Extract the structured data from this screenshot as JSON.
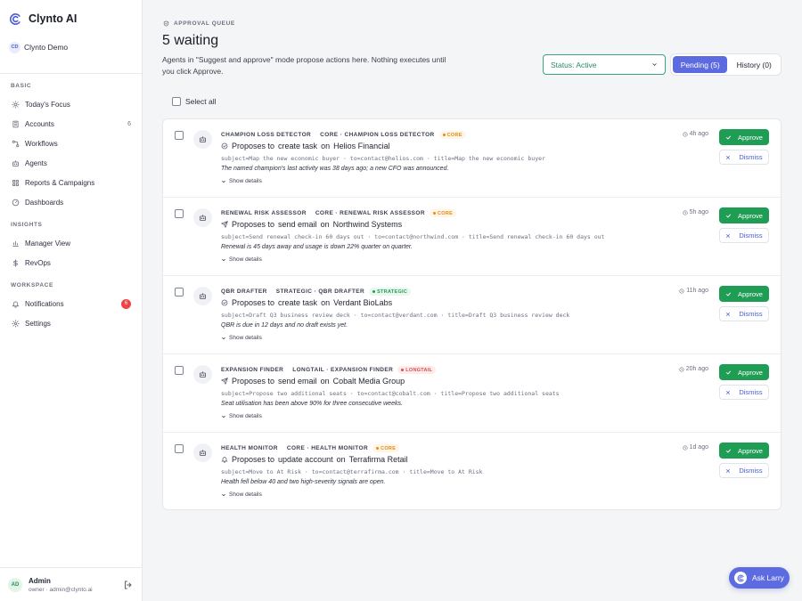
{
  "app": {
    "name": "Clynto AI",
    "workspace_initials": "CD",
    "workspace_name": "Clynto Demo"
  },
  "sidebar": {
    "sections": [
      {
        "label": "BASIC",
        "items": [
          {
            "label": "Today's Focus",
            "icon": "sun-icon"
          },
          {
            "label": "Accounts",
            "icon": "building-icon",
            "count": "6"
          },
          {
            "label": "Workflows",
            "icon": "workflow-icon"
          },
          {
            "label": "Agents",
            "icon": "robot-icon"
          },
          {
            "label": "Reports & Campaigns",
            "icon": "grid-icon"
          },
          {
            "label": "Dashboards",
            "icon": "gauge-icon"
          }
        ]
      },
      {
        "label": "INSIGHTS",
        "items": [
          {
            "label": "Manager View",
            "icon": "bar-chart-icon"
          },
          {
            "label": "RevOps",
            "icon": "dollar-icon"
          }
        ]
      },
      {
        "label": "WORKSPACE",
        "items": [
          {
            "label": "Notifications",
            "icon": "bell-icon",
            "badge": "6"
          },
          {
            "label": "Settings",
            "icon": "gear-icon"
          }
        ]
      }
    ]
  },
  "user": {
    "initials": "AD",
    "name": "Admin",
    "subtitle": "owner · admin@clynto.ai"
  },
  "header": {
    "eyebrow": "APPROVAL QUEUE",
    "title": "5 waiting",
    "description": "Agents in \"Suggest and approve\" mode propose actions here. Nothing executes until you click Approve.",
    "status_filter": "Status: Active",
    "tab_pending": "Pending (5)",
    "tab_history": "History (0)"
  },
  "select_all_label": "Select all",
  "proposes_to": "Proposes to",
  "on_word": "on",
  "approve_label": "Approve",
  "dismiss_label": "Dismiss",
  "show_details_label": "Show details",
  "colors": {
    "accent": "#5d6be0",
    "approve": "#1f9d55",
    "core": "#e8890c",
    "strategic": "#1f9d55",
    "longtail": "#e5484d"
  },
  "items": [
    {
      "agent": "CHAMPION LOSS DETECTOR",
      "group": "CORE · CHAMPION LOSS DETECTOR",
      "tier": "CORE",
      "tier_kind": "core",
      "action_icon": "check-circle-icon",
      "action": "create task",
      "target": "Helios Financial",
      "params": "subject=Map the new economic buyer · to=contact@helios.com · title=Map the new economic buyer",
      "reason": "The named champion's last activity was 38 days ago; a new CFO was announced.",
      "time": "4h ago"
    },
    {
      "agent": "RENEWAL RISK ASSESSOR",
      "group": "CORE · RENEWAL RISK ASSESSOR",
      "tier": "CORE",
      "tier_kind": "core",
      "action_icon": "send-icon",
      "action": "send email",
      "target": "Northwind Systems",
      "params": "subject=Send renewal check-in 60 days out · to=contact@northwind.com · title=Send renewal check-in 60 days out",
      "reason": "Renewal is 45 days away and usage is down 22% quarter on quarter.",
      "time": "5h ago"
    },
    {
      "agent": "QBR DRAFTER",
      "group": "STRATEGIC · QBR DRAFTER",
      "tier": "STRATEGIC",
      "tier_kind": "strategic",
      "action_icon": "check-circle-icon",
      "action": "create task",
      "target": "Verdant BioLabs",
      "params": "subject=Draft Q3 business review deck · to=contact@verdant.com · title=Draft Q3 business review deck",
      "reason": "QBR is due in 12 days and no draft exists yet.",
      "time": "11h ago"
    },
    {
      "agent": "EXPANSION FINDER",
      "group": "LONGTAIL · EXPANSION FINDER",
      "tier": "LONGTAIL",
      "tier_kind": "longtail",
      "action_icon": "send-icon",
      "action": "send email",
      "target": "Cobalt Media Group",
      "params": "subject=Propose two additional seats · to=contact@cobalt.com · title=Propose two additional seats",
      "reason": "Seat utilisation has been above 90% for three consecutive weeks.",
      "time": "20h ago"
    },
    {
      "agent": "HEALTH MONITOR",
      "group": "CORE · HEALTH MONITOR",
      "tier": "CORE",
      "tier_kind": "core",
      "action_icon": "bell-icon",
      "action": "update account",
      "target": "Terrafirma Retail",
      "params": "subject=Move to At Risk · to=contact@terrafirma.com · title=Move to At Risk",
      "reason": "Health fell below 40 and two high-severity signals are open.",
      "time": "1d ago"
    }
  ],
  "ask_larry_label": "Ask Larry"
}
